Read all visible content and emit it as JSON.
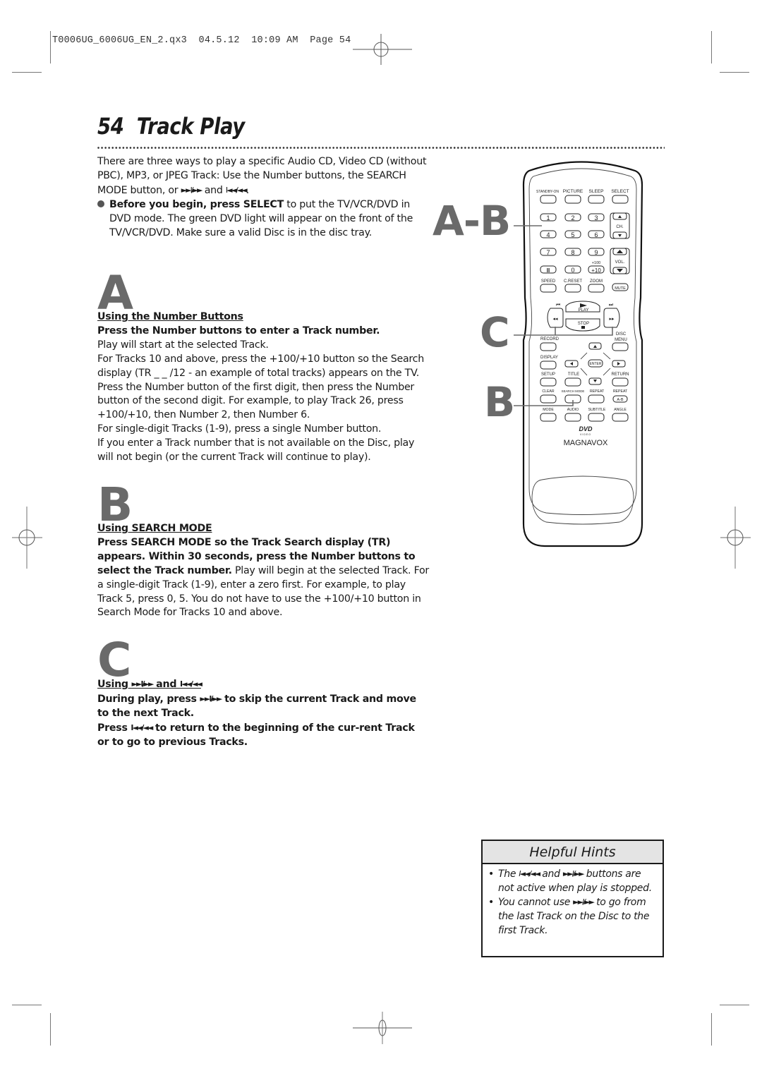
{
  "slug": {
    "text": "T0006UG_6006UG_EN_2.qx3  04.5.12  10:09 AM  Page 54"
  },
  "page": {
    "number": "54",
    "title": "Track Play"
  },
  "intro": {
    "text_1": "There are three ways to play a specific Audio CD, Video CD (without PBC), MP3, or JPEG Track: Use the Number buttons, the SEARCH MODE button, or ",
    "skip_fwd_symbol": "►►I/►►",
    "and": " and ",
    "skip_back_symbol": "I◄◄/◄◄",
    "end": ".",
    "bullet_bold": "Before you begin, press SELECT",
    "bullet_text": " to put the TV/VCR/DVD in DVD mode. The green DVD light will appear on the front of the TV/VCR/DVD.  Make sure a valid Disc  is in the disc tray."
  },
  "sections": [
    {
      "letter": "A",
      "heading": "Using the Number Buttons",
      "bold": "Press the Number buttons to enter a Track number.",
      "lines": [
        "Play will start at the selected Track.",
        "For Tracks 10 and above, press the +100/+10 button so the Search display (TR _ _ /12 - an example of total tracks)  appears on the TV.  Press the Number button of the first digit, then press the Number button of the second digit. For example, to play Track 26, press +100/+10, then Number 2, then Number 6.",
        "For single-digit Tracks (1-9), press a single Number button.",
        "If you enter a Track number that is not available on the Disc, play will not begin (or the current Track will continue to play)."
      ]
    },
    {
      "letter": "B",
      "heading": "Using SEARCH MODE",
      "bold": "Press SEARCH MODE so the Track Search display (TR) appears.  Within 30 seconds, press the Number buttons to select the Track number.",
      "text": "  Play will begin at the selected Track.  For a single-digit Track (1-9), enter a zero first. For example, to play Track 5, press 0, 5.  You do not have to use the +100/+10 button in Search Mode for Tracks 10 and above."
    },
    {
      "letter": "C",
      "heading_prefix": "Using ",
      "heading_fwd": "►►I/►►",
      "heading_and": " and ",
      "heading_back": "I◄◄/◄◄",
      "line1_a": "During play, press ",
      "line1_sym": "►►I/►►",
      "line1_b": " to skip the current Track and move to the next Track.",
      "line2_a": "Press ",
      "line2_sym": "I◄◄/◄◄",
      "line2_b": " to return to the beginning of the cur-rent Track or to go to previous Tracks."
    }
  ],
  "hints": {
    "title": "Helpful Hints",
    "items": [
      {
        "a": "The ",
        "sym1": "I◄◄/◄◄",
        "b": " and ",
        "sym2": "►►I/►►",
        "c": " buttons are not active when play is stopped."
      },
      {
        "a": "You cannot use ",
        "sym1": "►►I/►►",
        "b": " to go from the last Track on the Disc to the first Track."
      }
    ]
  },
  "callouts": {
    "ab": "A-B",
    "c": "C",
    "b": "B"
  },
  "remote": {
    "brand": "MAGNAVOX",
    "dvd_logo": "DVD",
    "dvd_sub": "VIDEO",
    "top_labels": [
      "STANDBY-ON",
      "PICTURE",
      "SLEEP",
      "SELECT"
    ],
    "digits": [
      "1",
      "2",
      "3",
      "4",
      "5",
      "6",
      "7",
      "8",
      "9",
      "II",
      "0",
      "+10"
    ],
    "plus100": "+100",
    "ch": "CH.",
    "vol": "VOL.",
    "row_labels": [
      "SPEED",
      "C.RESET",
      "ZOOM"
    ],
    "mute": "MUTE",
    "play": "PLAY",
    "stop": "STOP",
    "record": "RECORD",
    "disc_menu_1": "DISC",
    "disc_menu_2": "MENU",
    "display": "DISPLAY",
    "enter": "ENTER",
    "setup": "SETUP",
    "title_btn": "TITLE",
    "return": "RETURN",
    "lower_labels_1": [
      "CLEAR",
      "SEARCH MODE",
      "REPEAT",
      "REPEAT"
    ],
    "ab": "A-B",
    "lower_labels_2": [
      "MODE",
      "AUDIO",
      "SUBTITLE",
      "ANGLE"
    ]
  }
}
